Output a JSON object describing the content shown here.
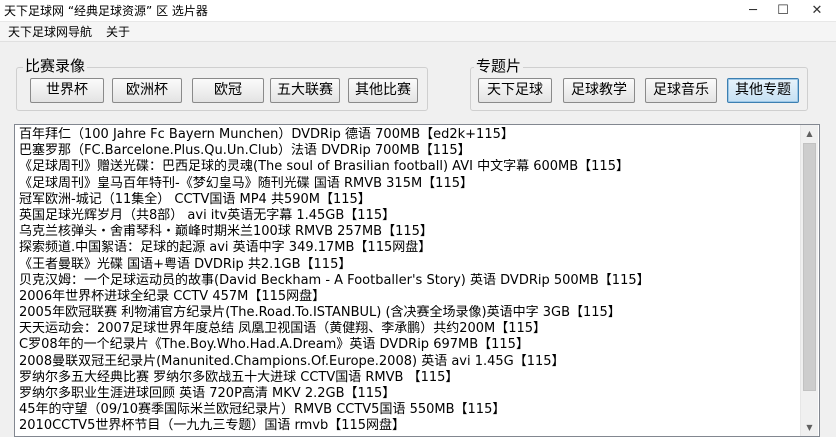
{
  "window": {
    "title": "天下足球网 “经典足球资源” 区 选片器",
    "minimize_glyph": "─",
    "maximize_glyph": "☐",
    "close_glyph": "✕"
  },
  "menu": [
    "天下足球网导航",
    "关于"
  ],
  "group_match": {
    "label": "比赛录像",
    "buttons": [
      "世界杯",
      "欧洲杯",
      "欧冠",
      "五大联赛",
      "其他比赛"
    ]
  },
  "group_topic": {
    "label": "专题片",
    "buttons": [
      "天下足球",
      "足球教学",
      "足球音乐",
      "其他专题"
    ],
    "active_index": 3
  },
  "list_items": [
    "百年拜仁（100 Jahre Fc Bayern Munchen）DVDRip 德语 700MB【ed2k+115】",
    "巴塞罗那（FC.Barcelone.Plus.Qu.Un.Club）法语 DVDRip 700MB【115】",
    "《足球周刊》赠送光碟：巴西足球的灵魂(The soul of Brasilian football) AVI 中文字幕 600MB【115】",
    "《足球周刊》皇马百年特刊-《梦幻皇马》随刊光碟 国语 RMVB 315M【115】",
    "冠军欧洲-城记（11集全） CCTV国语 MP4 共590M【115】",
    "英国足球光辉岁月（共8部） avi itv英语无字幕 1.45GB【115】",
    "乌克兰核弹头・舍甫琴科・巅峰时期米兰100球 RMVB 257MB【115】",
    "探索频道.中国絮语：足球的起源 avi 英语中字 349.17MB【115网盘】",
    "《王者曼联》光碟 国语+粤语 DVDRip 共2.1GB【115】",
    "贝克汉姆：一个足球运动员的故事(David Beckham - A Footballer's Story) 英语 DVDRip 500MB【115】",
    "2006年世界杯进球全纪录 CCTV 457M【115网盘】",
    "2005年欧冠联赛 利物浦官方纪录片(The.Road.To.ISTANBUL) (含决赛全场录像)英语中字 3GB【115】",
    "天天运动会：2007足球世界年度总结 凤凰卫视国语（黄健翔、李承鹏）共约200M【115】",
    "C罗08年的一个纪录片《The.Boy.Who.Had.A.Dream》英语 DVDRip 697MB【115】",
    "2008曼联双冠王纪录片(Manunited.Champions.Of.Europe.2008) 英语 avi 1.45G【115】",
    "罗纳尔多五大经典比赛 罗纳尔多欧战五十大进球 CCTV国语 RMVB 【115】",
    "罗纳尔多职业生涯进球回顾 英语 720P高清 MKV 2.2GB【115】",
    "45年的守望（09/10赛季国际米兰欧冠纪录片）RMVB CCTV5国语 550MB【115】",
    "2010CCTV5世界杯节目（一九九三专题）国语 rmvb【115网盘】"
  ],
  "scrollbar": {
    "up_glyph": "▲",
    "down_glyph": "▼"
  }
}
